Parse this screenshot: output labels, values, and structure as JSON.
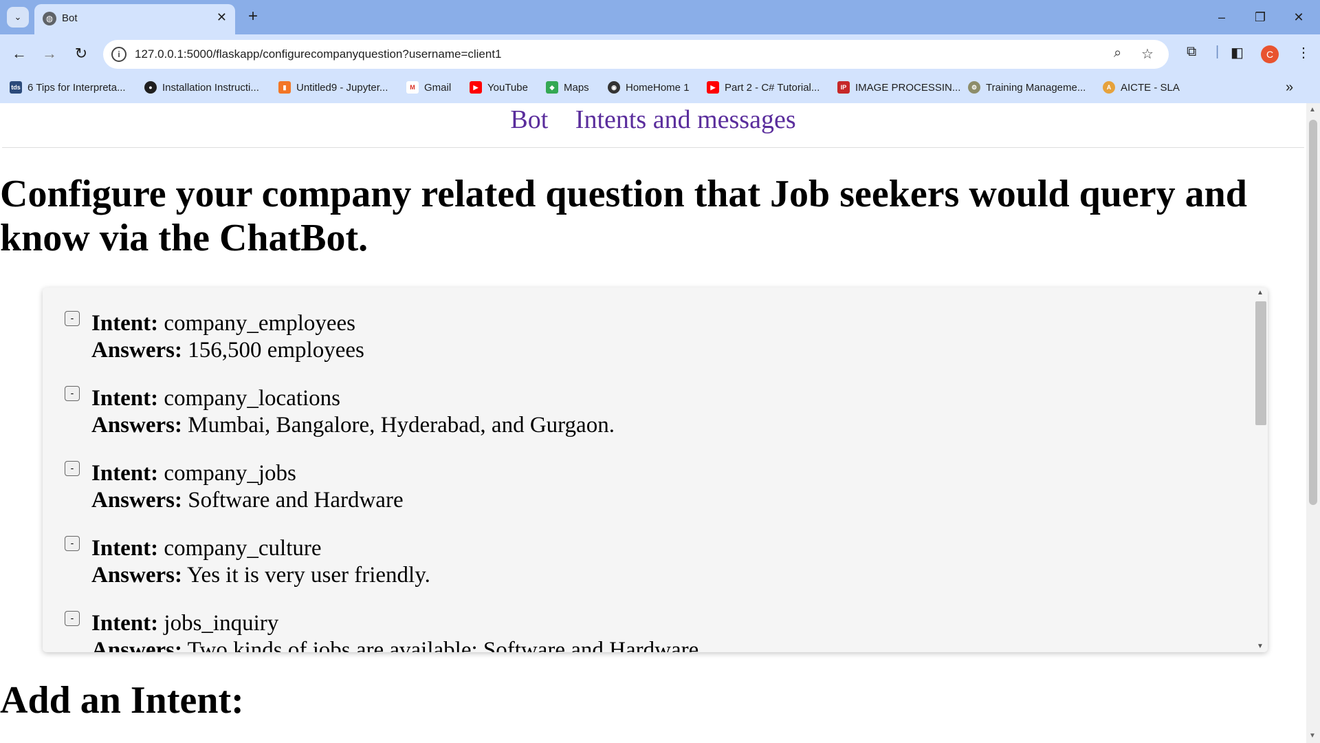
{
  "browser": {
    "tab_title": "Bot",
    "url": "127.0.0.1:5000/flaskapp/configurecompanyquestion?username=client1",
    "profile_initial": "C",
    "bookmarks": [
      {
        "label": "6 Tips for Interpreta...",
        "icon": "tds-icon",
        "color": "#2b4a7a",
        "glyph": "tds"
      },
      {
        "label": "Installation Instructi...",
        "icon": "github-icon",
        "color": "#1f1f1f",
        "glyph": "●"
      },
      {
        "label": "Untitled9 - Jupyter...",
        "icon": "jupyter-icon",
        "color": "#f37626",
        "glyph": "▮"
      },
      {
        "label": "Gmail",
        "icon": "gmail-icon",
        "color": "#d93025",
        "glyph": "M"
      },
      {
        "label": "YouTube",
        "icon": "youtube-icon",
        "color": "#ff0000",
        "glyph": "▶"
      },
      {
        "label": "Maps",
        "icon": "maps-icon",
        "color": "#34a853",
        "glyph": "◆"
      },
      {
        "label": "HomeHome 1",
        "icon": "globe-icon",
        "color": "#333333",
        "glyph": "◉"
      },
      {
        "label": "Part 2 - C# Tutorial...",
        "icon": "youtube-icon",
        "color": "#ff0000",
        "glyph": "▶"
      },
      {
        "label": "IMAGE PROCESSIN...",
        "icon": "image-processing-icon",
        "color": "#c62828",
        "glyph": "IP"
      },
      {
        "label": "Training Manageme...",
        "icon": "training-icon",
        "color": "#8d8d6a",
        "glyph": "⚙"
      },
      {
        "label": "AICTE - SLA",
        "icon": "aicte-icon",
        "color": "#e6a23c",
        "glyph": "A"
      }
    ]
  },
  "nav": {
    "bot": "Bot",
    "intents": "Intents and messages"
  },
  "heading": "Configure your company related question that Job seekers would query and know via the ChatBot.",
  "labels": {
    "intent": "Intent:",
    "answers": "Answers:",
    "collapse": "-"
  },
  "intents": [
    {
      "intent": "company_employees",
      "answer": "156,500 employees"
    },
    {
      "intent": "company_locations",
      "answer": "Mumbai, Bangalore, Hyderabad, and Gurgaon."
    },
    {
      "intent": "company_jobs",
      "answer": "Software and Hardware"
    },
    {
      "intent": "company_culture",
      "answer": "Yes it is very user friendly."
    },
    {
      "intent": "jobs_inquiry",
      "answer": "Two kinds of jobs are available: Software and Hardware"
    }
  ],
  "add_heading": "Add an Intent:"
}
